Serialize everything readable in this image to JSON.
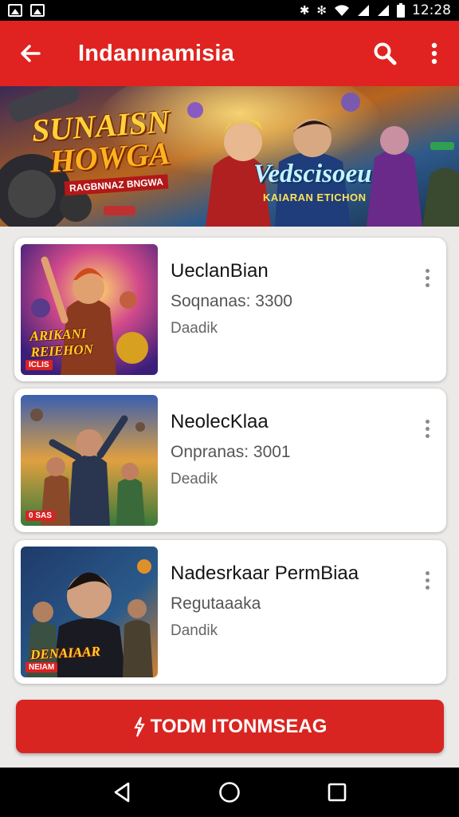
{
  "status_bar": {
    "time": "12:28",
    "left_icons": [
      "gallery-icon",
      "image-icon"
    ],
    "right_icons": [
      "bug-icon",
      "bluetooth-icon",
      "wifi-icon",
      "signal-icon",
      "signal-icon",
      "battery-icon"
    ]
  },
  "app_bar": {
    "title": "Indanınamisia",
    "back_icon": "arrow-left-icon",
    "search_icon": "search-icon",
    "more_icon": "more-vert-icon",
    "color": "#e02320"
  },
  "banner": {
    "title_line1": "SUNAISN",
    "title_line2": "HOWGA",
    "subtitle_left": "RAGBNNAZ BNGWA",
    "title_right": "Vedscisoeu",
    "subtitle_right": "KAIARAN ETICHON"
  },
  "cards": [
    {
      "title": "UeclanBian",
      "subtitle": "Soqnanas: 3300",
      "meta": "Daadik",
      "thumb_label_1": "ARIKANI",
      "thumb_label_2": "REIEHON",
      "thumb_badge": "ICLIS"
    },
    {
      "title": "NeolecKlaa",
      "subtitle": "Onpranas: 3001",
      "meta": "Deadik",
      "thumb_badge": "0 SAS"
    },
    {
      "title": "Nadesrkaar PermBiaa",
      "subtitle": "Regutaaaka",
      "meta": "Dandik",
      "thumb_label_1": "DENAIAAR",
      "thumb_badge": "NEIAM"
    }
  ],
  "cta": {
    "icon": "lightning-icon",
    "label": "TODM ITONMSEAG",
    "color": "#d92521"
  },
  "nav_bar": {
    "back_icon": "triangle-back-icon",
    "home_icon": "circle-home-icon",
    "recents_icon": "square-recents-icon"
  }
}
